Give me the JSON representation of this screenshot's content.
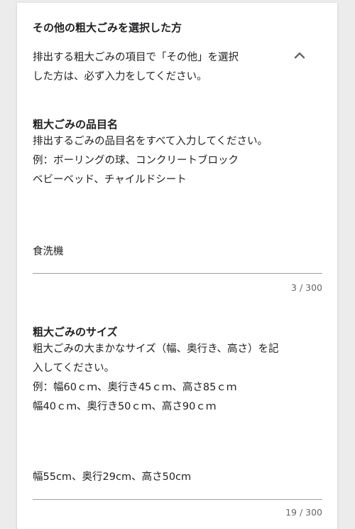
{
  "section": {
    "title": "その他の粗大ごみを選択した方",
    "desc_line1": "排出する粗大ごみの項目で「その他」を選択",
    "desc_line2": "した方は、必ず入力をしてください。"
  },
  "questions": [
    {
      "title": "粗大ごみの品目名",
      "help": [
        "排出するごみの品目名をすべて入力してください。",
        "例：ボーリングの球、コンクリートブロック",
        "ベビーベッド、チャイルドシート"
      ],
      "answer": "食洗機",
      "counter": "3 / 300"
    },
    {
      "title": "粗大ごみのサイズ",
      "help": [
        "粗大ごみの大まかなサイズ（幅、奥行き、高さ）を記",
        "入してください。",
        "例：幅60ｃｍ、奥行き45ｃｍ、高さ85ｃｍ",
        "幅40ｃｍ、奥行き50ｃｍ、高さ90ｃｍ"
      ],
      "answer": "幅55cm、奥行29cm、高さ50cm",
      "counter": "19 / 300"
    }
  ]
}
